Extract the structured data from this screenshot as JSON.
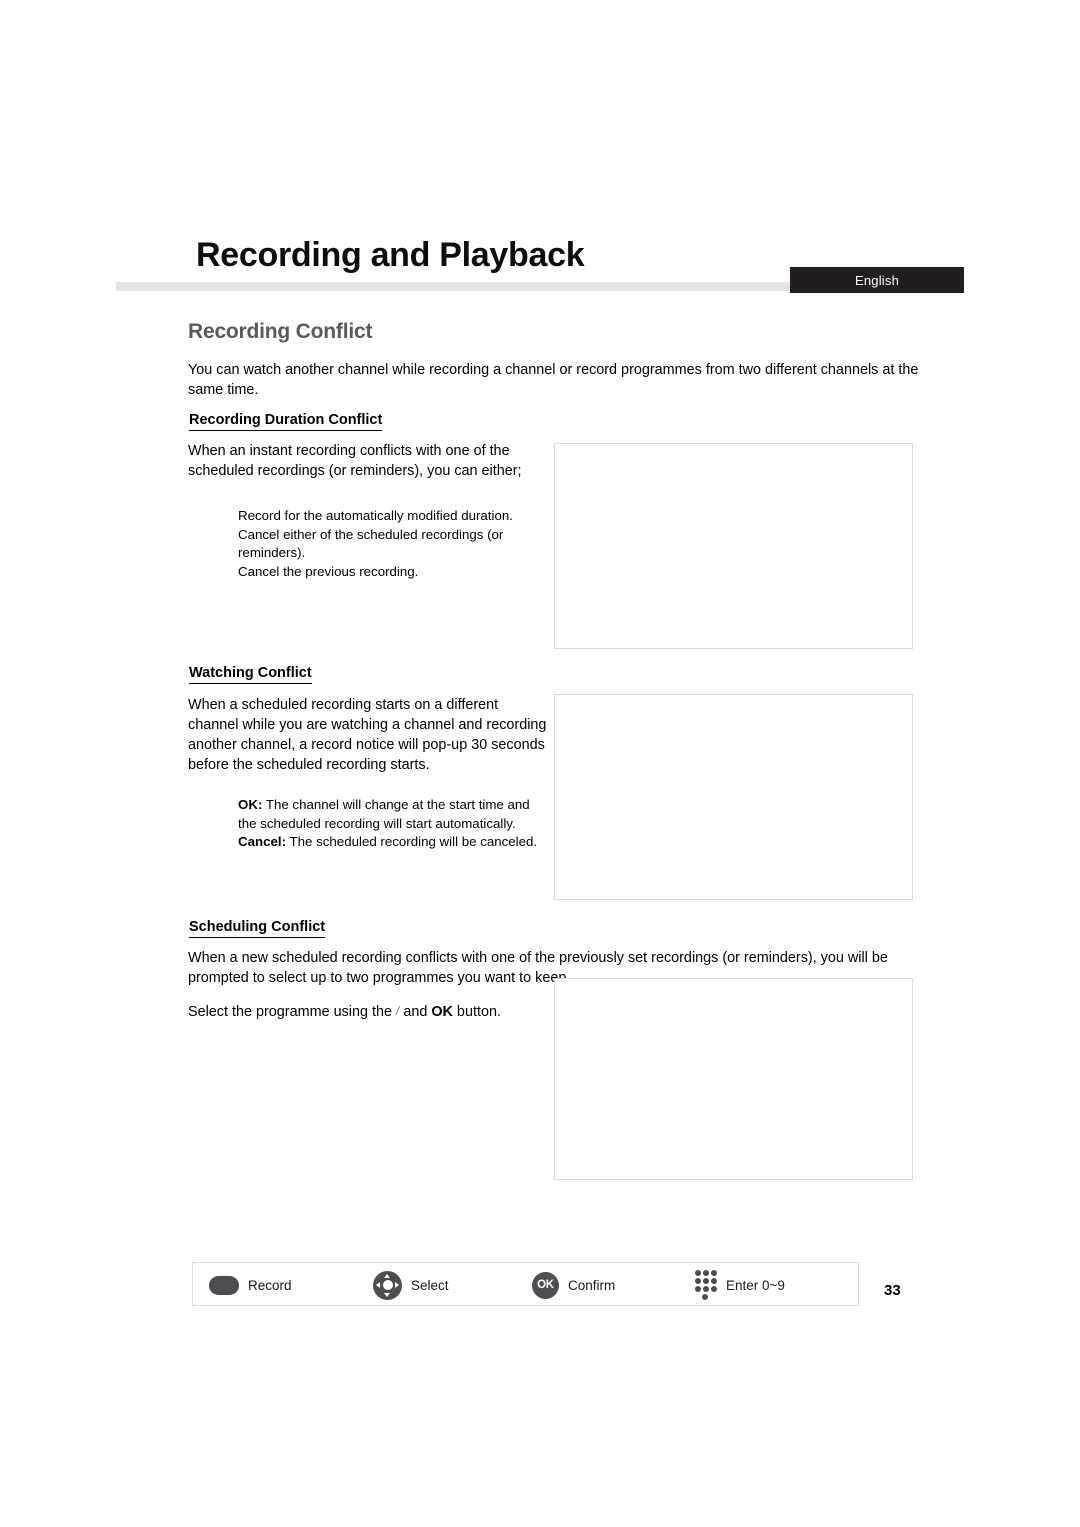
{
  "header": {
    "title": "Recording and Playback",
    "language_badge": "English"
  },
  "section": {
    "title": "Recording Conflict",
    "intro": "You can watch another channel while recording a channel or record programmes from two different channels at the same time."
  },
  "subsections": [
    {
      "heading": "Recording Duration Conflict",
      "body": "When an instant recording conflicts with one of the scheduled recordings (or reminders), you can either;",
      "bullets": [
        "Record for the automatically modified duration.",
        "Cancel either of the scheduled recordings (or reminders).",
        "Cancel the previous recording."
      ]
    },
    {
      "heading": "Watching Conflict",
      "body": "When a scheduled recording starts on a different channel while you are watching a channel and recording another channel, a record notice will pop-up 30 seconds before the scheduled recording starts.",
      "notes": [
        {
          "label": "OK:",
          "text": " The channel will change at the start time and the scheduled recording will start automatically."
        },
        {
          "label": "Cancel:",
          "text": " The scheduled recording will be canceled."
        }
      ]
    },
    {
      "heading": "Scheduling Conflict",
      "body": "When a new scheduled recording conflicts with one of the previously set recordings (or reminders), you will be prompted to select up to two programmes you want to keep.",
      "select_line_prefix": "Select the programme using the ",
      "select_line_glyph": "/",
      "select_line_mid": " and ",
      "select_line_bold": "OK",
      "select_line_suffix": " button."
    }
  ],
  "legend": {
    "items": [
      {
        "icon": "record-button-icon",
        "label": "Record"
      },
      {
        "icon": "dpad-icon",
        "label": "Select"
      },
      {
        "icon": "ok-button-icon",
        "label": "Confirm",
        "icon_text": "OK"
      },
      {
        "icon": "number-keypad-icon",
        "label": "Enter 0~9"
      }
    ]
  },
  "footer": {
    "page_number": "33"
  },
  "colors": {
    "badge_background": "#231f20",
    "rule_gray": "#e4e4e4",
    "section_title_gray": "#58595b",
    "icon_gray": "#4d4d52",
    "figure_border": "#d9d9d9"
  }
}
